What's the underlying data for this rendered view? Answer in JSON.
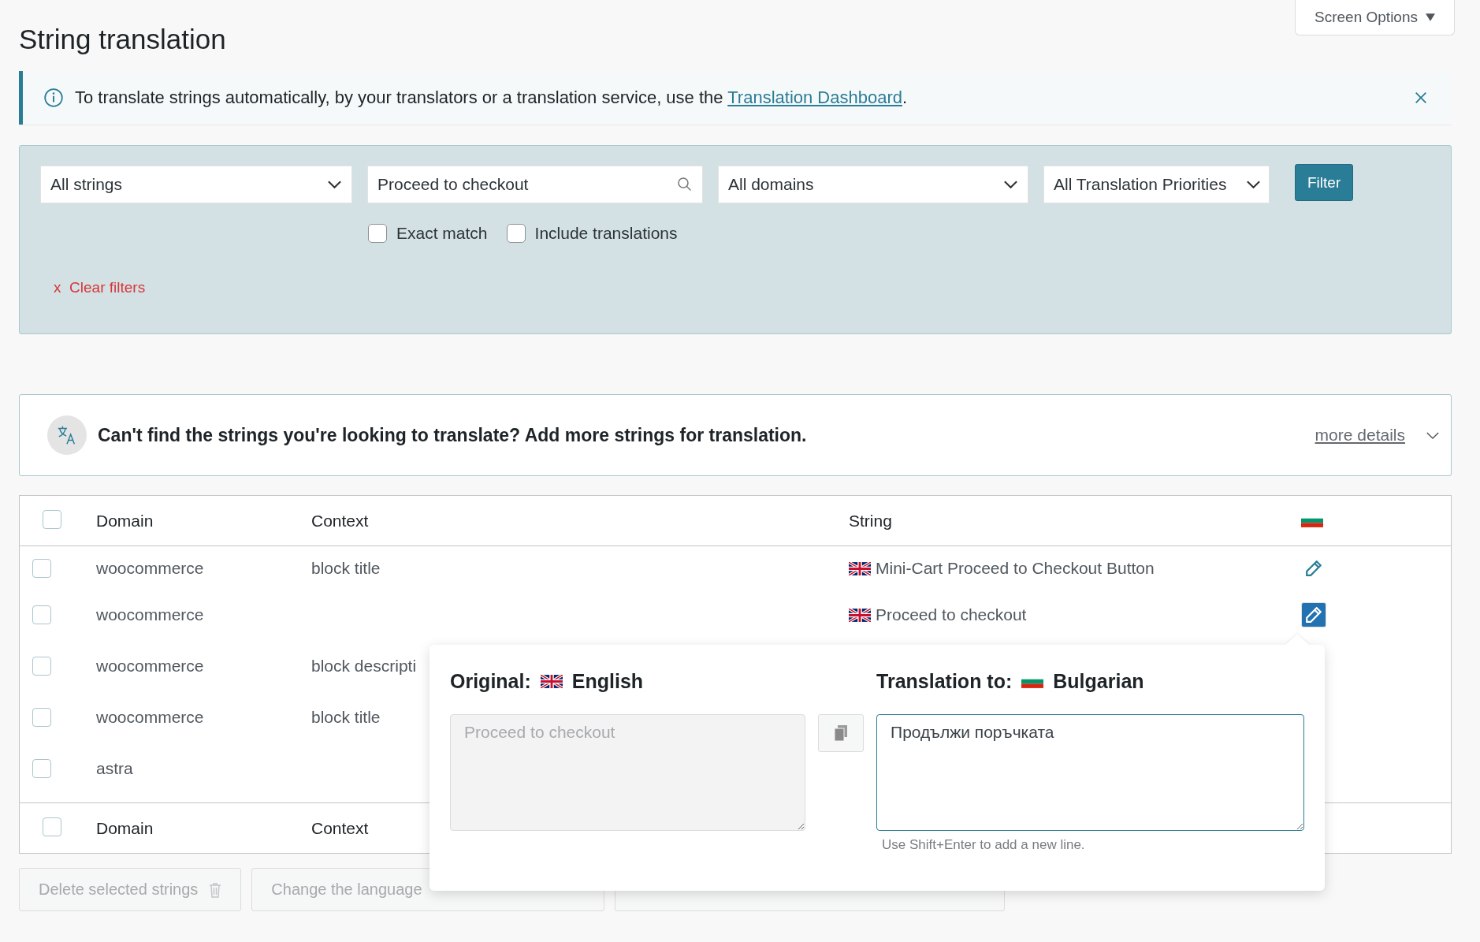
{
  "screen_options": {
    "label": "Screen Options",
    "expanded": false
  },
  "title": "String translation",
  "notice": {
    "text": "To translate strings automatically, by your translators or a translation service, use the ",
    "link": "Translation Dashboard",
    "end": "."
  },
  "filters": {
    "string_status": "All strings",
    "search": "Proceed to checkout",
    "domain": "All domains",
    "priority": "All Translation Priorities",
    "button": "Filter",
    "options": [
      {
        "label": "Exact match",
        "checked": false
      },
      {
        "label": "Include translations",
        "checked": false
      }
    ],
    "clear_mark": "x",
    "clear": "Clear filters"
  },
  "more_strings": {
    "text": "Can't find the strings you're looking to translate? Add more strings for translation.",
    "link": "more details",
    "expanded": false
  },
  "table": {
    "columns": [
      "Domain",
      "Context",
      "String"
    ],
    "header_checked": false,
    "rows": [
      {
        "checked": false,
        "domain": "woocommerce",
        "context": "block title",
        "string": "Mini-Cart Proceed to Checkout Button",
        "edit": {
          "selected": false
        }
      },
      {
        "checked": false,
        "domain": "woocommerce",
        "string": "Proceed to checkout",
        "edit": {
          "selected": true
        }
      },
      {
        "checked": false,
        "domain": "woocommerce",
        "context": "block descripti"
      },
      {
        "checked": false,
        "domain": "woocommerce",
        "context": "block title"
      },
      {
        "checked": false,
        "domain": "astra"
      }
    ],
    "footer_columns": [
      "Domain",
      "Context"
    ],
    "footer_checked": false
  },
  "bulk_actions": [
    "Delete selected strings",
    "Change the language"
  ],
  "editor": {
    "original_label": "Original:",
    "original_language": "English",
    "original_field": {
      "placeholder": "Proceed to checkout"
    },
    "target_label": "Translation to:",
    "target_language": "Bulgarian",
    "translation": "Продължи поръчката",
    "hint": "Use Shift+Enter to add a new line."
  }
}
